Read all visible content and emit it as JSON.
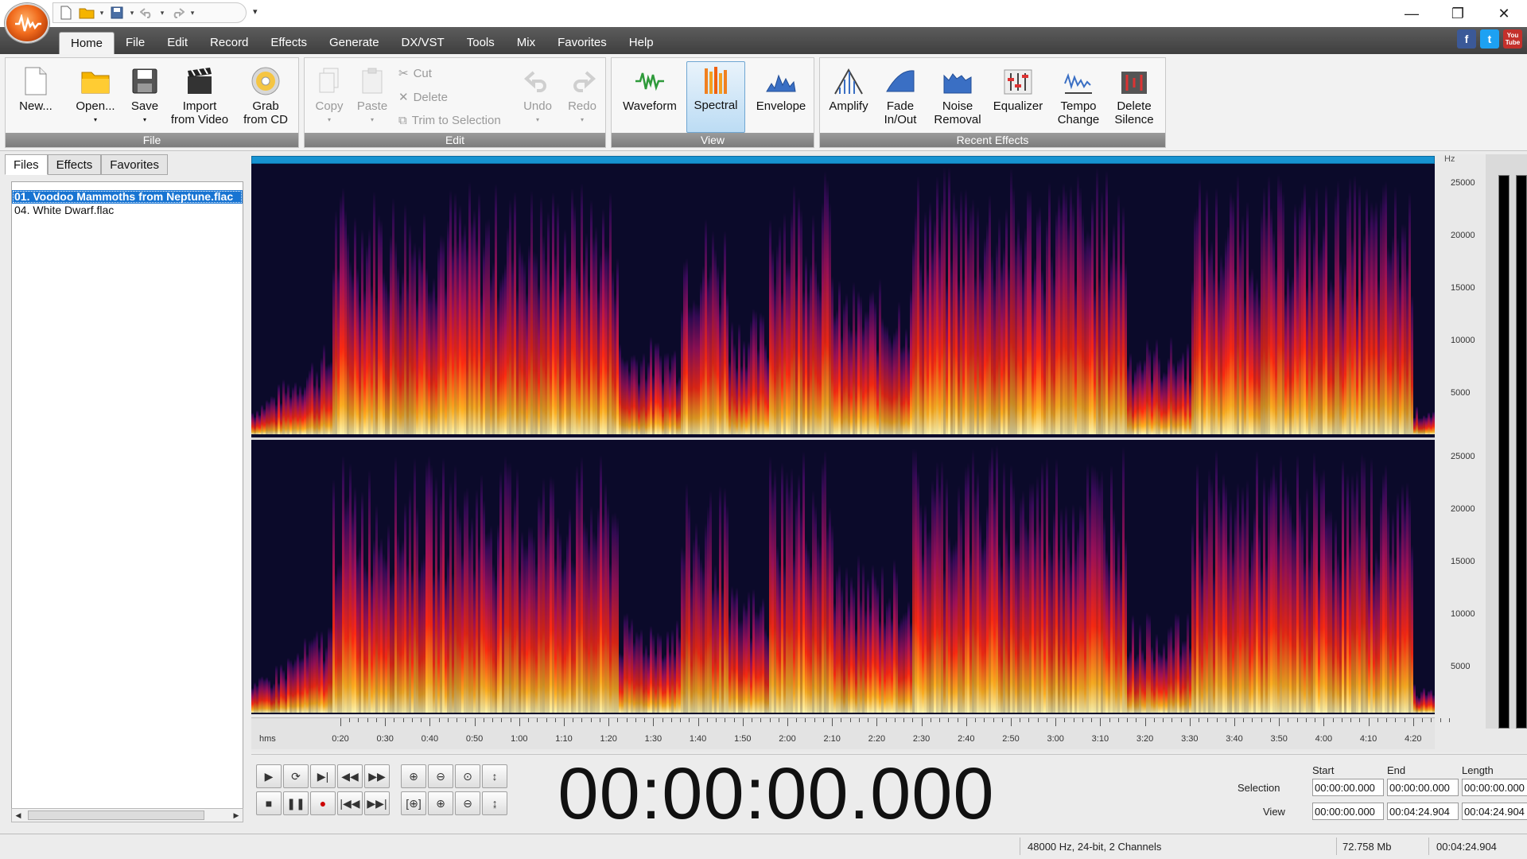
{
  "menu": {
    "items": [
      "Home",
      "File",
      "Edit",
      "Record",
      "Effects",
      "Generate",
      "DX/VST",
      "Tools",
      "Mix",
      "Favorites",
      "Help"
    ]
  },
  "ribbon": {
    "file_group": {
      "title": "File",
      "new_label": "New...",
      "open_label": "Open...",
      "save_label": "Save",
      "import_label_1": "Import",
      "import_label_2": "from Video",
      "grab_label_1": "Grab",
      "grab_label_2": "from CD"
    },
    "edit_group": {
      "title": "Edit",
      "copy_label": "Copy",
      "paste_label": "Paste",
      "cut_label": "Cut",
      "delete_label": "Delete",
      "trim_label": "Trim to Selection",
      "undo_label": "Undo",
      "redo_label": "Redo"
    },
    "view_group": {
      "title": "View",
      "waveform_label": "Waveform",
      "spectral_label": "Spectral",
      "envelope_label": "Envelope"
    },
    "effects_group": {
      "title": "Recent Effects",
      "amplify_label": "Amplify",
      "fade_label_1": "Fade",
      "fade_label_2": "In/Out",
      "noise_label_1": "Noise",
      "noise_label_2": "Removal",
      "equalizer_label": "Equalizer",
      "tempo_label_1": "Tempo",
      "tempo_label_2": "Change",
      "silence_label_1": "Delete",
      "silence_label_2": "Silence"
    }
  },
  "left_panel": {
    "tabs": [
      "Files",
      "Effects",
      "Favorites"
    ],
    "files": [
      "01. Voodoo Mammoths from Neptune.flac",
      "04. White Dwarf.flac"
    ]
  },
  "freq_scale": {
    "unit": "Hz",
    "labels": [
      "25000",
      "20000",
      "15000",
      "10000",
      "5000"
    ]
  },
  "timeline": {
    "unit": "hms",
    "labels": [
      "0:20",
      "0:30",
      "0:40",
      "0:50",
      "1:00",
      "1:10",
      "1:20",
      "1:30",
      "1:40",
      "1:50",
      "2:00",
      "2:10",
      "2:20",
      "2:30",
      "2:40",
      "2:50",
      "3:00",
      "3:10",
      "3:20",
      "3:30",
      "3:40",
      "3:50",
      "4:00",
      "4:10",
      "4:20"
    ]
  },
  "transport": {
    "current_time": "00:00:00.000"
  },
  "selection": {
    "start_header": "Start",
    "end_header": "End",
    "length_header": "Length",
    "selection_label": "Selection",
    "view_label": "View",
    "sel_start": "00:00:00.000",
    "sel_end": "00:00:00.000",
    "sel_length": "00:00:00.000",
    "view_start": "00:00:00.000",
    "view_end": "00:04:24.904",
    "view_length": "00:04:24.904"
  },
  "status": {
    "format": "48000 Hz, 24-bit, 2 Channels",
    "size": "72.758 Mb",
    "duration": "00:04:24.904"
  },
  "social": {
    "facebook": "f",
    "twitter": "t",
    "youtube": "You Tube"
  },
  "colors": {
    "accent": "#1793d1",
    "selection": "#1874d2",
    "spectro_bg": "#0b0a2a"
  }
}
